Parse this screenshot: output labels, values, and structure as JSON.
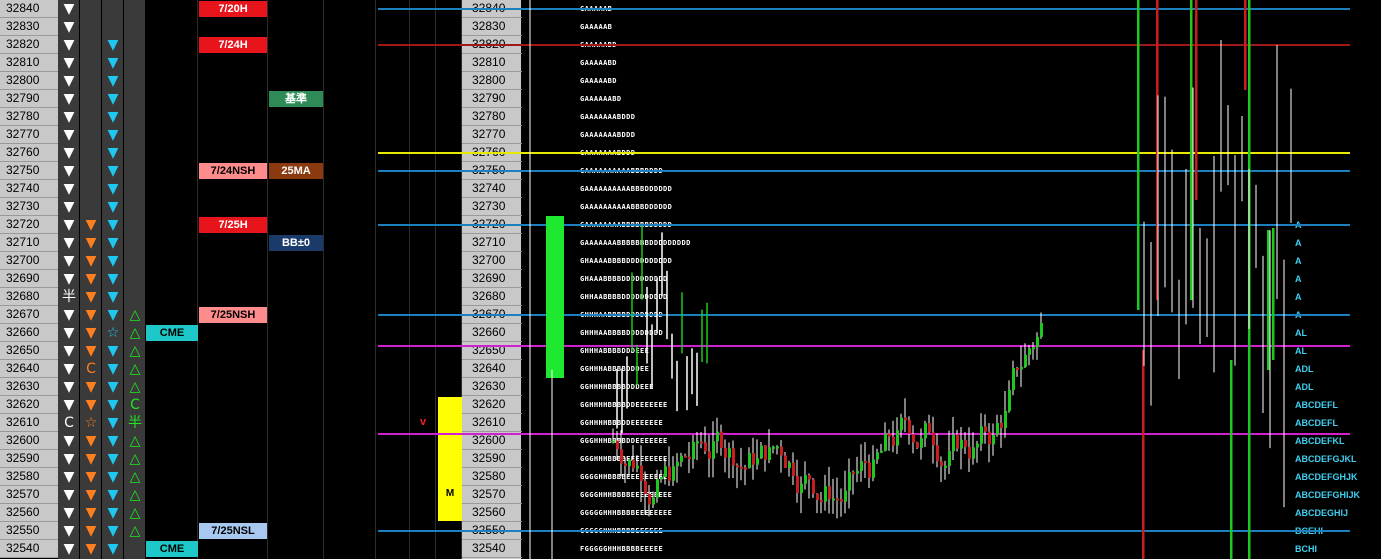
{
  "prices": [
    32840,
    32830,
    32820,
    32810,
    32800,
    32790,
    32780,
    32770,
    32760,
    32750,
    32740,
    32730,
    32720,
    32710,
    32700,
    32690,
    32680,
    32670,
    32660,
    32650,
    32640,
    32630,
    32620,
    32610,
    32600,
    32590,
    32580,
    32570,
    32560,
    32550,
    32540
  ],
  "col1": [
    "▼",
    "▼",
    "▼",
    "▼",
    "▼",
    "▼",
    "▼",
    "▼",
    "▼",
    "▼",
    "▼",
    "▼",
    "▼",
    "▼",
    "▼",
    "▼",
    "半",
    "▼",
    "▼",
    "▼",
    "▼",
    "▼",
    "▼",
    "C",
    "▼",
    "▼",
    "▼",
    "▼",
    "▼",
    "▼",
    "▼"
  ],
  "col2": [
    "",
    "",
    "",
    "",
    "",
    "",
    "",
    "",
    "",
    "",
    "",
    "",
    "▼",
    "▼",
    "▼",
    "▼",
    "▼",
    "▼",
    "▼",
    "▼",
    "C",
    "▼",
    "▼",
    "☆",
    "▼",
    "▼",
    "▼",
    "▼",
    "▼",
    "▼",
    "▼"
  ],
  "col3": [
    "",
    "",
    "▼",
    "▼",
    "▼",
    "▼",
    "▼",
    "▼",
    "▼",
    "▼",
    "▼",
    "▼",
    "▼",
    "▼",
    "▼",
    "▼",
    "▼",
    "▼",
    "☆",
    "▼",
    "▼",
    "▼",
    "▼",
    "▼",
    "▼",
    "▼",
    "▼",
    "▼",
    "▼",
    "▼",
    "▼"
  ],
  "col4": [
    "",
    "",
    "",
    "",
    "",
    "",
    "",
    "",
    "",
    "",
    "",
    "",
    "",
    "",
    "",
    "",
    "",
    "△",
    "△",
    "△",
    "△",
    "△",
    "C",
    "半",
    "△",
    "△",
    "△",
    "△",
    "△",
    "△",
    ""
  ],
  "cme_tags": [
    {
      "row": 18,
      "text": "CME"
    },
    {
      "row": 30,
      "text": "CME"
    }
  ],
  "date_tags": [
    {
      "row": 0,
      "text": "7/20H",
      "bg": "#e8141c",
      "fg": "#ffffff"
    },
    {
      "row": 2,
      "text": "7/24H",
      "bg": "#e8141c",
      "fg": "#ffffff"
    },
    {
      "row": 9,
      "text": "7/24NSH",
      "bg": "#ff8c8c",
      "fg": "#000000"
    },
    {
      "row": 12,
      "text": "7/25H",
      "bg": "#e8141c",
      "fg": "#ffffff"
    },
    {
      "row": 17,
      "text": "7/25NSH",
      "bg": "#ff8c8c",
      "fg": "#000000"
    },
    {
      "row": 29,
      "text": "7/25NSL",
      "bg": "#a8c8f0",
      "fg": "#000000"
    }
  ],
  "indicator_tags": [
    {
      "row": 5,
      "text": "基準",
      "bg": "#2e8b57",
      "fg": "#ffffff"
    },
    {
      "row": 9,
      "text": "25MA",
      "bg": "#8b3a0f",
      "fg": "#ffffff"
    },
    {
      "row": 13,
      "text": "BB±0",
      "bg": "#1a3a6a",
      "fg": "#ffffff"
    }
  ],
  "v_marker": {
    "row": 23,
    "text": "v"
  },
  "yellow_box": {
    "text": "M"
  },
  "tpo_profile": [
    "GAAAAAB",
    "GAAAAAB",
    "GAAAAABD",
    "GAAAAABD",
    "GAAAAABD",
    "GAAAAAABD",
    "GAAAAAAABDDD",
    "GAAAAAAABDDD",
    "GAAAAAAABDDD",
    "GAAAAAAAAAABBBDDDD",
    "GAAAAAAAAAABBBDDDDDD",
    "GAAAAAAAAAABBBDDDDDD",
    "GAAAAAAAABBBBBBDDDDD",
    "GAAAAAAABBBBBBBDDDDDDDDD",
    "GHAAAABBBBDDDDDDDDDD",
    "GHAAABBBBDDDDDDDDDD",
    "GHHAABBBBDDDDDDDDDD",
    "GHHHAABBBBDDDDDDDD",
    "GHHHAABBBBDDDDDDDD",
    "GHHHABBBBDDDEEE",
    "GGHHHABBBBDDDEE",
    "GGHHHHBBBBDDDEEE",
    "GGHHHHBBBBDDEEEEEEE",
    "GGHHHHBBBDDEEEEEEE",
    "GGGHHHBBBBDDEEEEEEE",
    "GGGHHHBBBBEEEEEEEEE",
    "GGGGHHBBBBEEEEEEEEE",
    "GGGGHHHBBBBEEEEEEEEE",
    "GGGGGHHHBBBBEEEEEEEE",
    "GGGGGHHHBBBBEEEEEE",
    "FGGGGGHHHBBBBEEEEE"
  ],
  "right_labels": [
    {
      "row": 12,
      "text": "A"
    },
    {
      "row": 13,
      "text": "A"
    },
    {
      "row": 14,
      "text": "A"
    },
    {
      "row": 15,
      "text": "A"
    },
    {
      "row": 16,
      "text": "A"
    },
    {
      "row": 17,
      "text": "A"
    },
    {
      "row": 18,
      "text": "AL"
    },
    {
      "row": 19,
      "text": "AL"
    },
    {
      "row": 20,
      "text": "ADL"
    },
    {
      "row": 21,
      "text": "ADL"
    },
    {
      "row": 22,
      "text": "ABCDEFL"
    },
    {
      "row": 23,
      "text": "ABCDEFL"
    },
    {
      "row": 24,
      "text": "ABCDEFKL"
    },
    {
      "row": 25,
      "text": "ABCDEFGJKL"
    },
    {
      "row": 26,
      "text": "ABCDEFGHJK"
    },
    {
      "row": 27,
      "text": "ABCDEFGHIJK"
    },
    {
      "row": 28,
      "text": "ABCDEGHIJ"
    },
    {
      "row": 29,
      "text": "BCEHI"
    },
    {
      "row": 30,
      "text": "BCHI"
    }
  ],
  "hlines": [
    {
      "price": 32840,
      "color": "#1e7fc0"
    },
    {
      "price": 32820,
      "color": "#a01818"
    },
    {
      "price": 32760,
      "color": "#e8e800"
    },
    {
      "price": 32750,
      "color": "#1e7fc0"
    },
    {
      "price": 32720,
      "color": "#1e7fc0"
    },
    {
      "price": 32670,
      "color": "#1e7fc0"
    },
    {
      "price": 32653,
      "color": "#d020d0"
    },
    {
      "price": 32604,
      "color": "#d020d0"
    },
    {
      "price": 32550,
      "color": "#1e7fc0"
    }
  ],
  "volume_bar": {
    "top_price": 32720,
    "bottom_price": 32640,
    "color": "#1ee830"
  },
  "colors": {
    "green": "#1ec81e",
    "red": "#c81e1e",
    "white": "#ffffff",
    "orange": "#ff7f1e",
    "cyan": "#1ec8f0"
  }
}
